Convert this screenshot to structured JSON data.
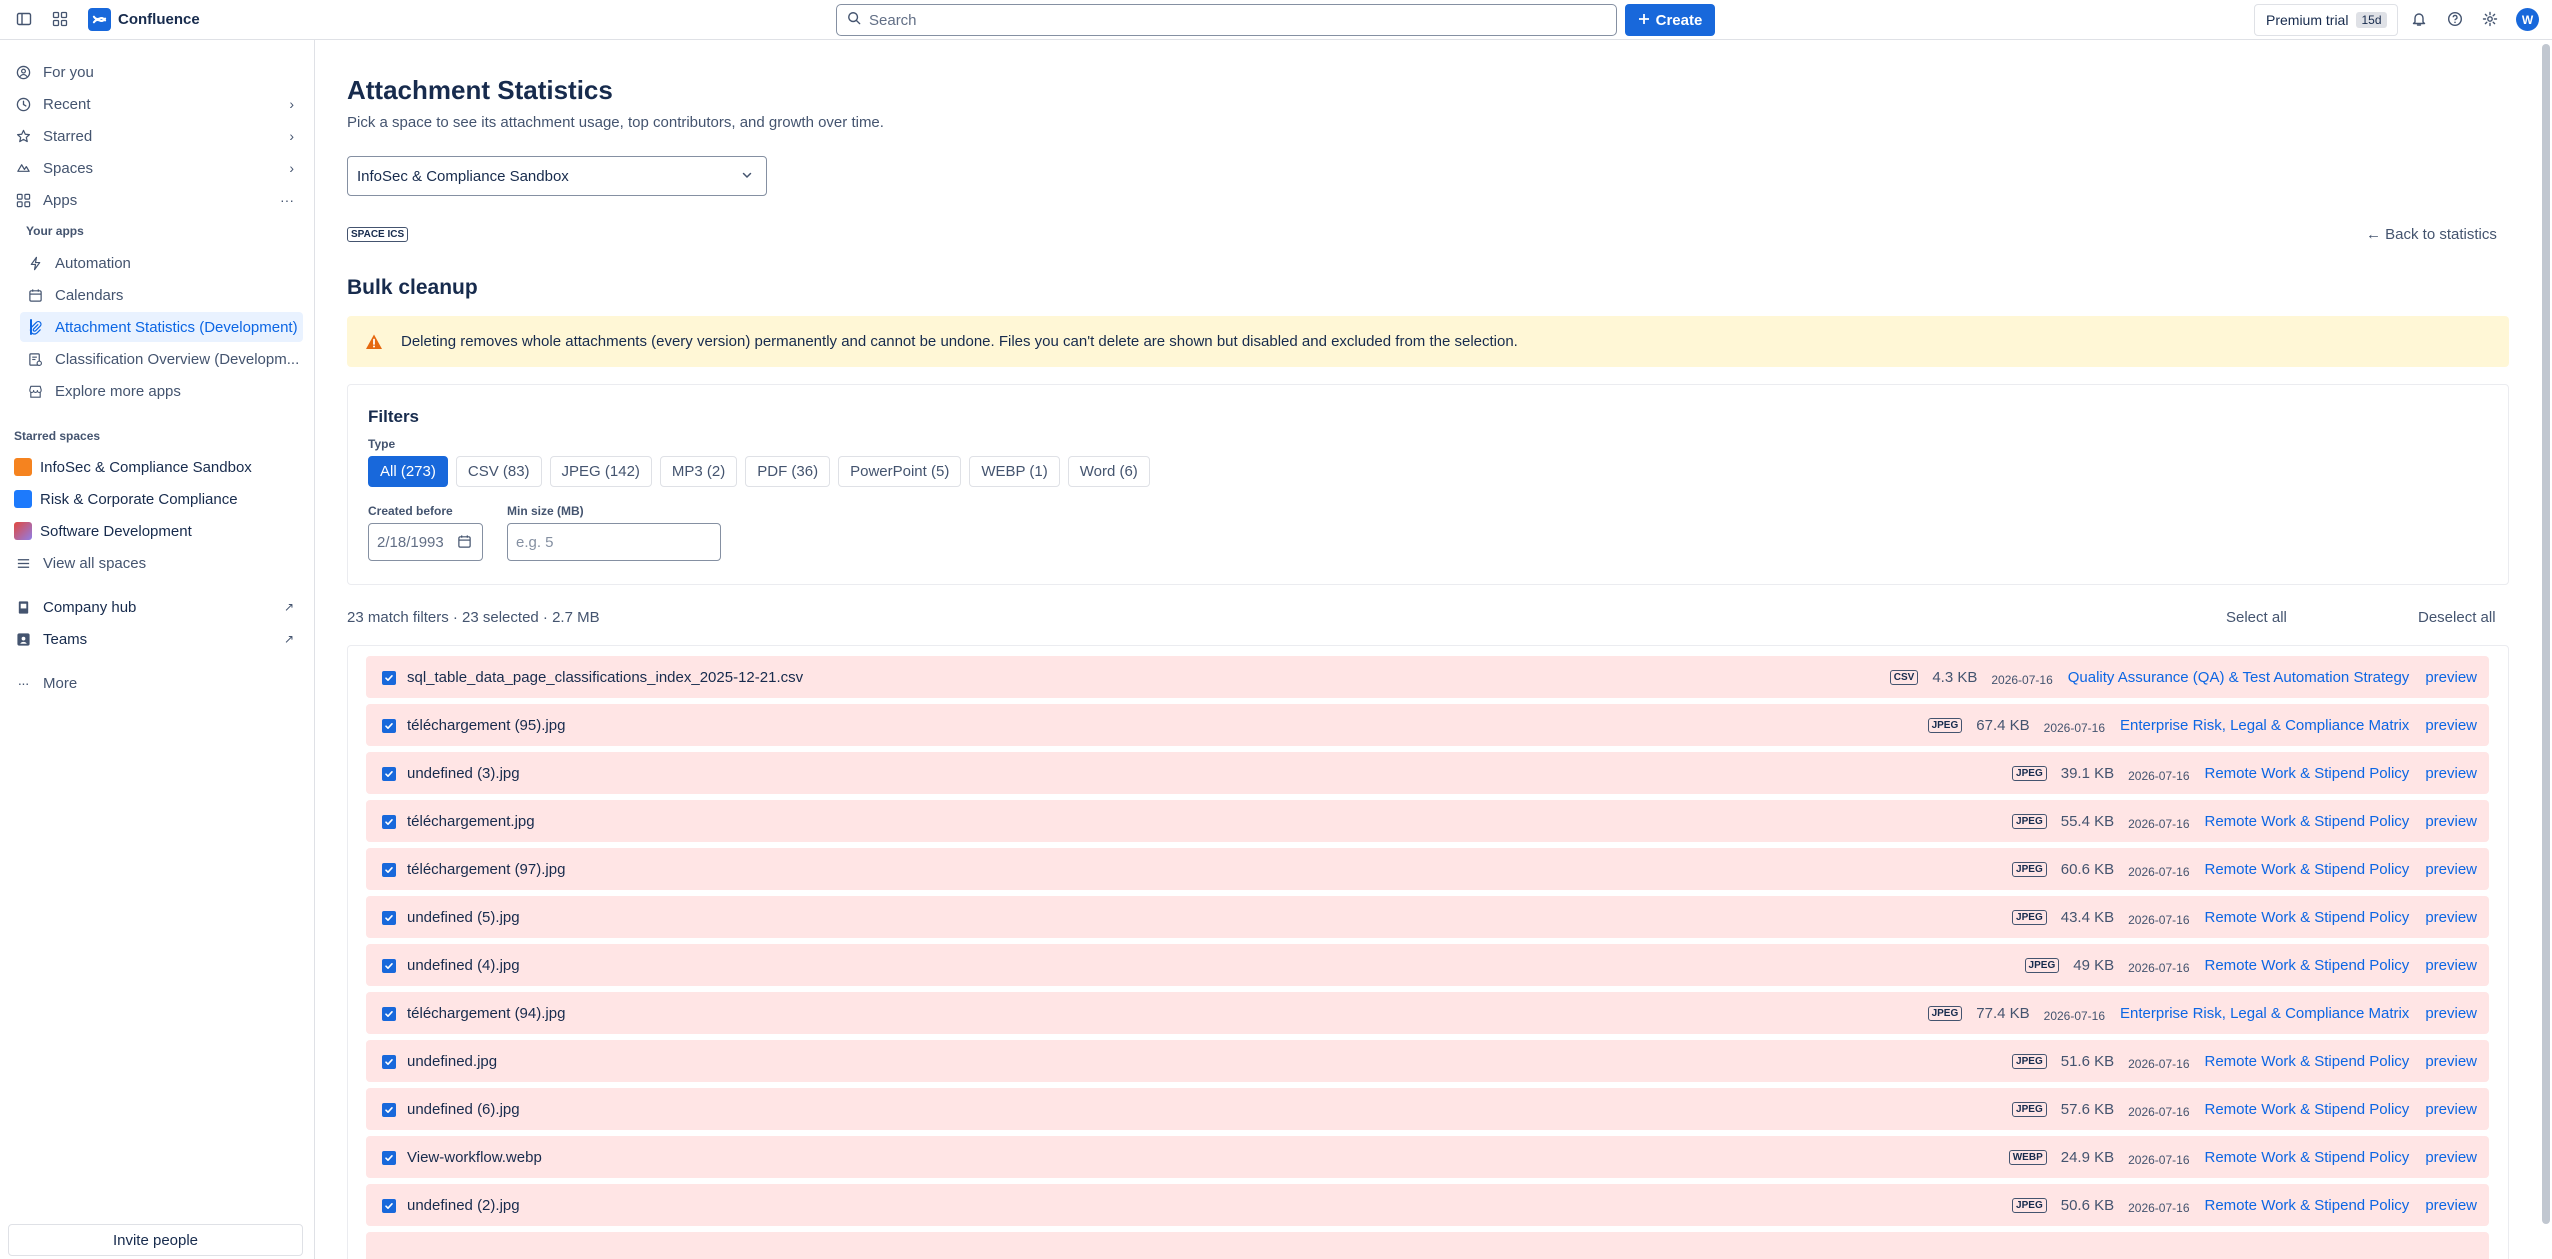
{
  "topbar": {
    "brand": "Confluence",
    "search_placeholder": "Search",
    "create_label": "Create",
    "premium_label": "Premium trial",
    "premium_badge": "15d",
    "avatar_initial": "W"
  },
  "sidebar": {
    "items": [
      {
        "label": "For you",
        "icon": "person-circle-icon"
      },
      {
        "label": "Recent",
        "icon": "clock-icon"
      },
      {
        "label": "Starred",
        "icon": "star-icon"
      },
      {
        "label": "Spaces",
        "icon": "spaces-icon"
      },
      {
        "label": "Apps",
        "icon": "apps-icon"
      }
    ],
    "your_apps_label": "Your apps",
    "apps": [
      {
        "label": "Automation",
        "icon": "lightning-icon"
      },
      {
        "label": "Calendars",
        "icon": "calendar-icon"
      },
      {
        "label": "Attachment Statistics (Development)",
        "icon": "paperclip-icon"
      },
      {
        "label": "Classification Overview (Developm...",
        "icon": "classification-icon"
      },
      {
        "label": "Explore more apps",
        "icon": "store-icon"
      }
    ],
    "starred_spaces_label": "Starred spaces",
    "starred_spaces": [
      {
        "label": "InfoSec & Compliance Sandbox",
        "color": "#f5831f"
      },
      {
        "label": "Risk & Corporate Compliance",
        "color": "#1d7afc"
      },
      {
        "label": "Software Development",
        "color": "#e2483d"
      }
    ],
    "view_all_spaces": "View all spaces",
    "company_hub": "Company hub",
    "teams": "Teams",
    "more": "More",
    "invite": "Invite people"
  },
  "main": {
    "title": "Attachment Statistics",
    "subtitle": "Pick a space to see its attachment usage, top contributors, and growth over time.",
    "selected_space": "InfoSec & Compliance Sandbox",
    "space_tag": "SPACE ICS",
    "back_link": "← Back to statistics",
    "bulk_title": "Bulk cleanup",
    "warning": "Deleting removes whole attachments (every version) permanently and cannot be undone. Files you can't delete are shown but disabled and excluded from the selection.",
    "filters": {
      "title": "Filters",
      "type_label": "Type",
      "chips": [
        "All (273)",
        "CSV (83)",
        "JPEG (142)",
        "MP3 (2)",
        "PDF (36)",
        "PowerPoint (5)",
        "WEBP (1)",
        "Word (6)"
      ],
      "active_chip": 0,
      "created_before_label": "Created before",
      "created_before_placeholder": "2/18/1993",
      "min_size_label": "Min size (MB)",
      "min_size_placeholder": "e.g. 5"
    },
    "summary": "23 match filters · 23 selected · 2.7 MB",
    "select_all": "Select all",
    "deselect_all": "Deselect all",
    "preview_label": "preview",
    "rows": [
      {
        "name": "sql_table_data_page_classifications_index_2025-12-21.csv",
        "type": "CSV",
        "size": "4.3 KB",
        "date": "2026-07-16",
        "page": "Quality Assurance (QA) & Test Automation Strategy"
      },
      {
        "name": "téléchargement (95).jpg",
        "type": "JPEG",
        "size": "67.4 KB",
        "date": "2026-07-16",
        "page": "Enterprise Risk, Legal & Compliance Matrix"
      },
      {
        "name": "undefined (3).jpg",
        "type": "JPEG",
        "size": "39.1 KB",
        "date": "2026-07-16",
        "page": "Remote Work & Stipend Policy"
      },
      {
        "name": "téléchargement.jpg",
        "type": "JPEG",
        "size": "55.4 KB",
        "date": "2026-07-16",
        "page": "Remote Work & Stipend Policy"
      },
      {
        "name": "téléchargement (97).jpg",
        "type": "JPEG",
        "size": "60.6 KB",
        "date": "2026-07-16",
        "page": "Remote Work & Stipend Policy"
      },
      {
        "name": "undefined (5).jpg",
        "type": "JPEG",
        "size": "43.4 KB",
        "date": "2026-07-16",
        "page": "Remote Work & Stipend Policy"
      },
      {
        "name": "undefined (4).jpg",
        "type": "JPEG",
        "size": "49 KB",
        "date": "2026-07-16",
        "page": "Remote Work & Stipend Policy"
      },
      {
        "name": "téléchargement (94).jpg",
        "type": "JPEG",
        "size": "77.4 KB",
        "date": "2026-07-16",
        "page": "Enterprise Risk, Legal & Compliance Matrix"
      },
      {
        "name": "undefined.jpg",
        "type": "JPEG",
        "size": "51.6 KB",
        "date": "2026-07-16",
        "page": "Remote Work & Stipend Policy"
      },
      {
        "name": "undefined (6).jpg",
        "type": "JPEG",
        "size": "57.6 KB",
        "date": "2026-07-16",
        "page": "Remote Work & Stipend Policy"
      },
      {
        "name": "View-workflow.webp",
        "type": "WEBP",
        "size": "24.9 KB",
        "date": "2026-07-16",
        "page": "Remote Work & Stipend Policy"
      },
      {
        "name": "undefined (2).jpg",
        "type": "JPEG",
        "size": "50.6 KB",
        "date": "2026-07-16",
        "page": "Remote Work & Stipend Policy"
      }
    ]
  }
}
